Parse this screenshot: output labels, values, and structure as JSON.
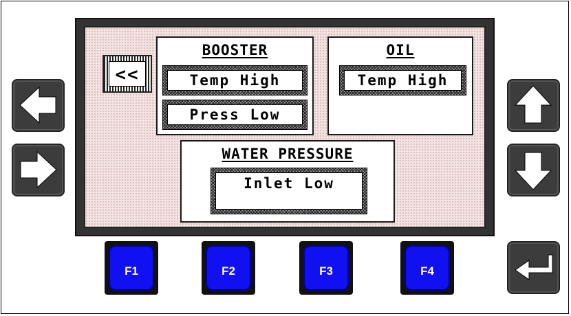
{
  "screen": {
    "back_label": "<<",
    "booster": {
      "title": "BOOSTER",
      "alarms": [
        "Temp High",
        "Press Low"
      ]
    },
    "oil": {
      "title": "OIL",
      "alarms": [
        "Temp High"
      ]
    },
    "water": {
      "title": "WATER PRESSURE",
      "alarms": [
        "Inlet Low"
      ]
    }
  },
  "keys": {
    "f1": "F1",
    "f2": "F2",
    "f3": "F3",
    "f4": "F4"
  },
  "icons": {
    "left": "arrow-left-icon",
    "right": "arrow-right-icon",
    "up": "arrow-up-icon",
    "down": "arrow-down-icon",
    "enter": "enter-icon"
  },
  "colors": {
    "fkey": "#1010f0",
    "nav": "#3c3c3c",
    "bezel": "#333333",
    "screen": "#f3e3e3"
  }
}
